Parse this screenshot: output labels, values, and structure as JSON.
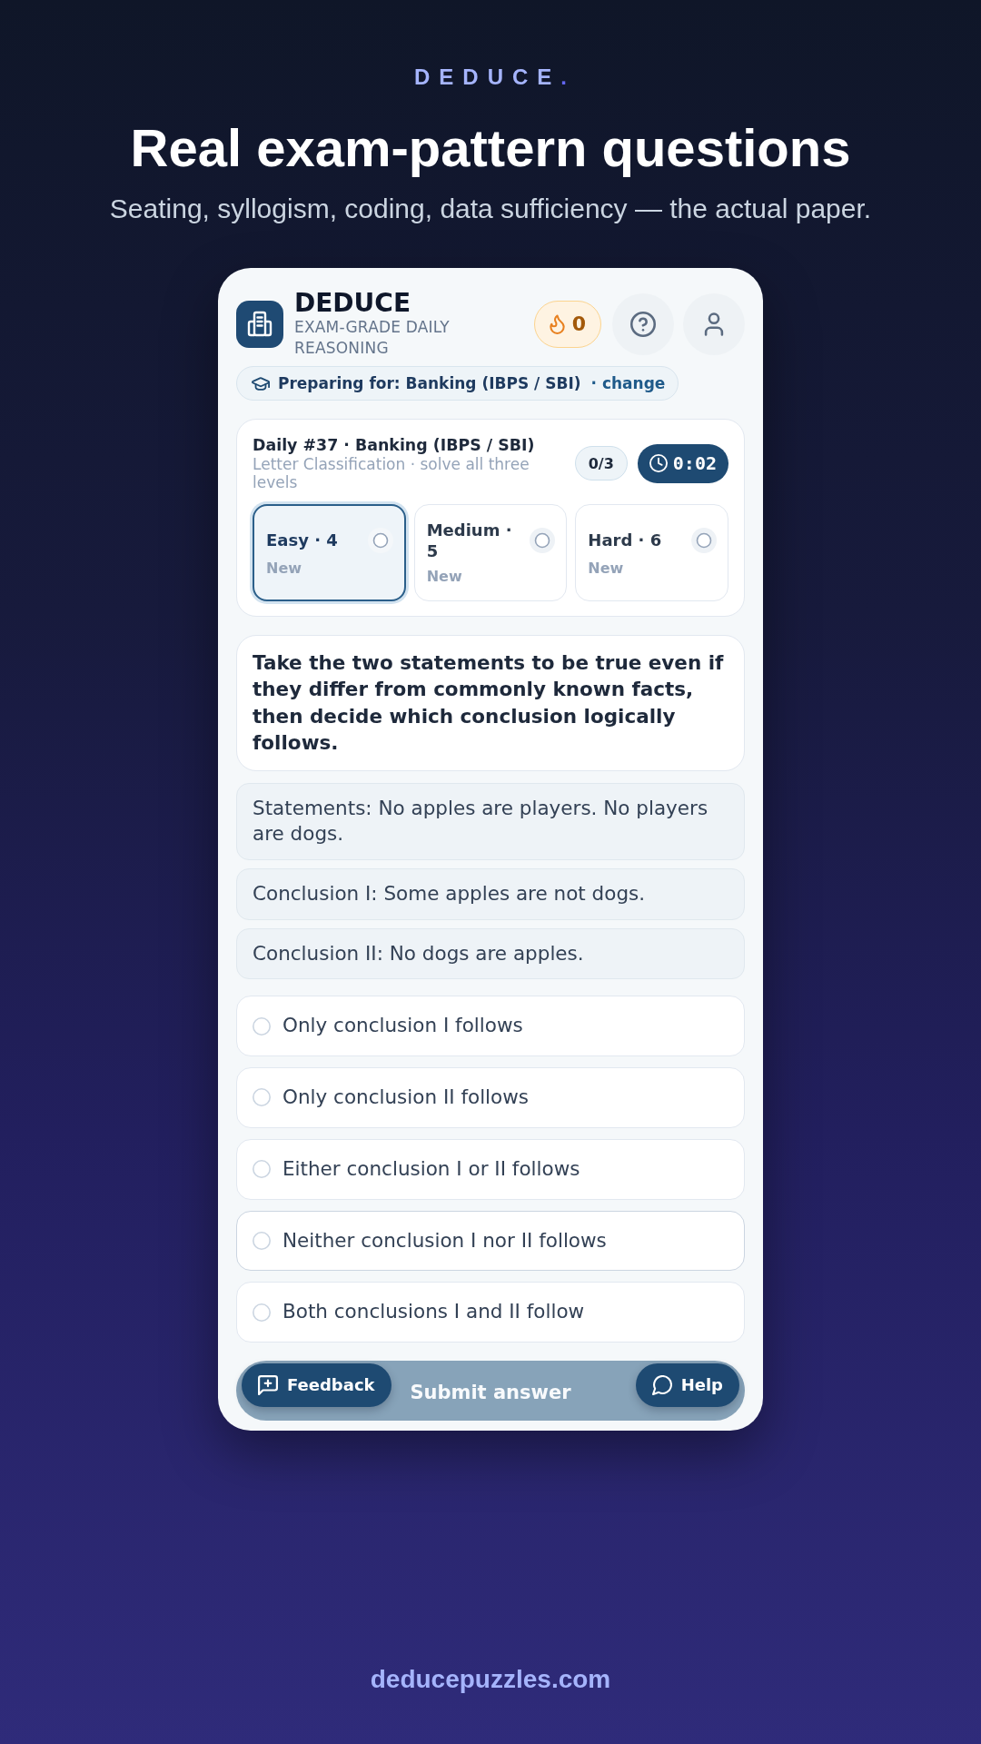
{
  "hero": {
    "brand": "DEDUCE",
    "brand_accent": ".",
    "headline": "Real exam-pattern questions",
    "subtitle": "Seating, syllogism, coding, data sufficiency — the actual paper."
  },
  "app": {
    "title": "DEDUCE",
    "tagline": "EXAM-GRADE DAILY REASONING",
    "streak": {
      "count": "0"
    },
    "exam": {
      "label": "Preparing for: Banking (IBPS / SBI)",
      "link": "· change"
    },
    "daily": {
      "title": "Daily #37 · Banking (IBPS / SBI)",
      "subtitle": "Letter Classification · solve all three levels",
      "progress": "0/3",
      "timer": "0:02"
    },
    "levels": [
      {
        "label": "Easy · 4",
        "status": "New",
        "selected": true
      },
      {
        "label": "Medium · 5",
        "status": "New",
        "selected": false
      },
      {
        "label": "Hard · 6",
        "status": "New",
        "selected": false
      }
    ],
    "question": {
      "prompt": "Take the two statements to be true even if they differ from commonly known facts, then decide which conclusion logically follows.",
      "premises": [
        "Statements: No apples are players. No players are dogs.",
        "Conclusion I: Some apples are not dogs.",
        "Conclusion II: No dogs are apples."
      ]
    },
    "options": [
      {
        "text": "Only conclusion I follows",
        "selected": false,
        "hovered": false
      },
      {
        "text": "Only conclusion II follows",
        "selected": false,
        "hovered": false
      },
      {
        "text": "Either conclusion I or II follows",
        "selected": false,
        "hovered": false
      },
      {
        "text": "Neither conclusion I nor II follows",
        "selected": false,
        "hovered": true
      },
      {
        "text": "Both conclusions I and II follow",
        "selected": false,
        "hovered": false
      }
    ],
    "actions": {
      "submit": {
        "label": "Submit answer",
        "disabled": true
      },
      "feedback": "Feedback",
      "help": "Help"
    }
  },
  "footer": {
    "site": "deducepuzzles.com"
  }
}
